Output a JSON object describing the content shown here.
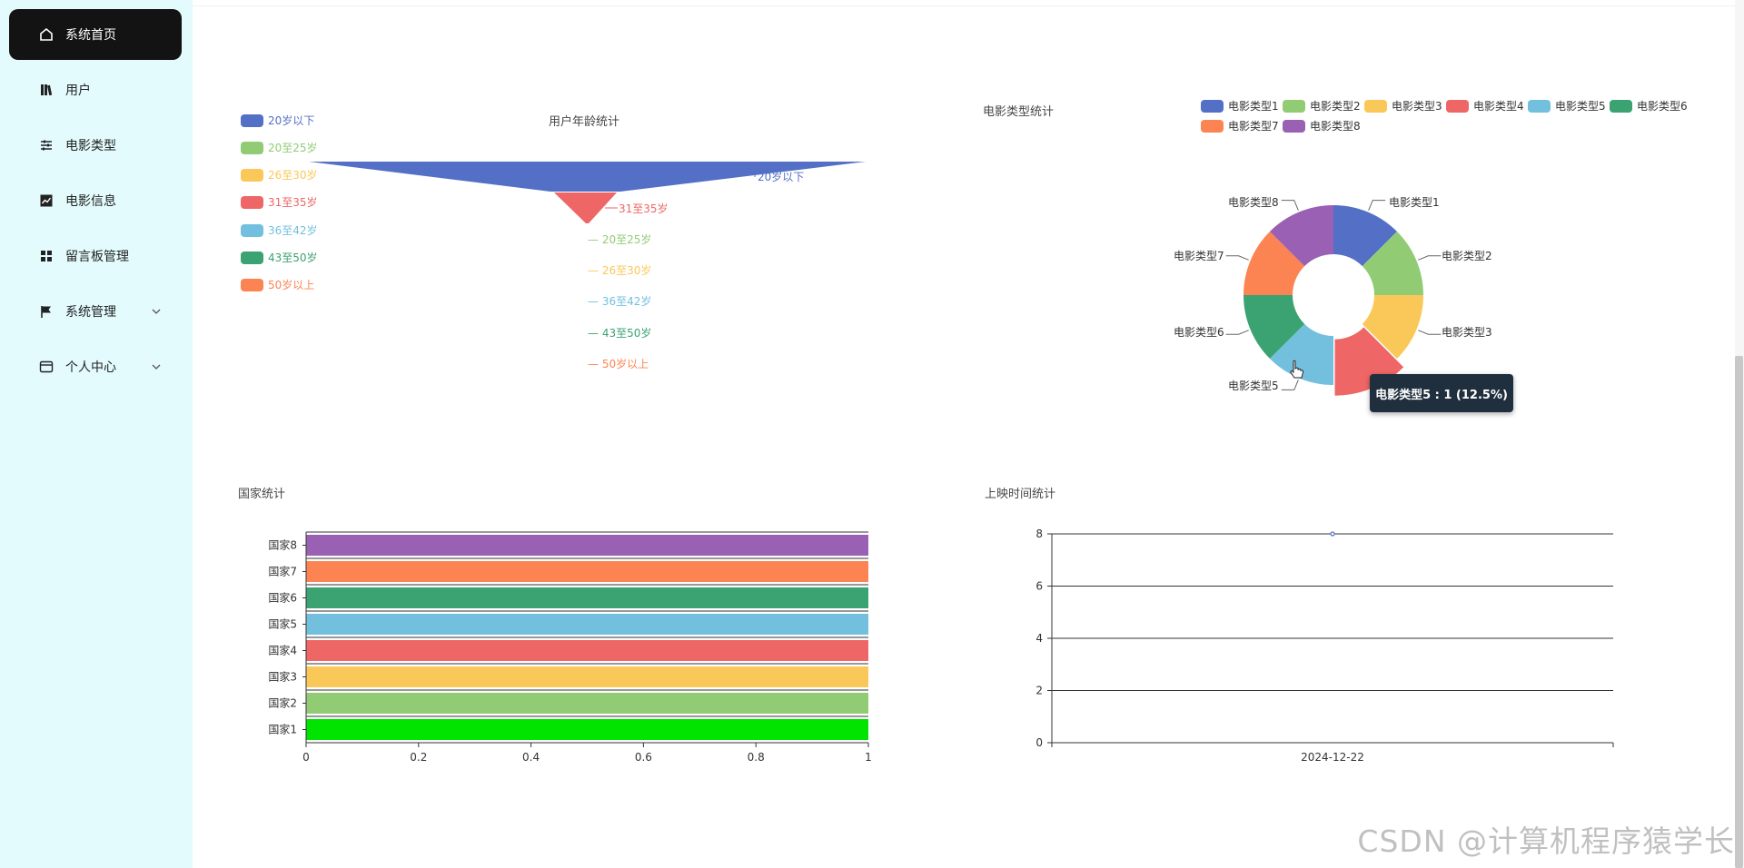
{
  "sidebar": {
    "items": [
      {
        "label": "系统首页",
        "icon": "home-icon",
        "active": true
      },
      {
        "label": "用户",
        "icon": "book-icon"
      },
      {
        "label": "电影类型",
        "icon": "sliders-icon"
      },
      {
        "label": "电影信息",
        "icon": "chart-icon"
      },
      {
        "label": "留言板管理",
        "icon": "grid-icon"
      },
      {
        "label": "系统管理",
        "icon": "flag-icon",
        "expandable": true
      },
      {
        "label": "个人中心",
        "icon": "card-icon",
        "expandable": true
      }
    ]
  },
  "colors": {
    "blue": "#5470c6",
    "green": "#91cc75",
    "yellow": "#fac858",
    "red": "#ee6666",
    "cyan": "#73c0de",
    "teal": "#3ba272",
    "orange": "#fc8452",
    "purple": "#9a60b4",
    "lime": "#00e400"
  },
  "chart_data": [
    {
      "type": "funnel",
      "title": "用户年龄统计",
      "categories": [
        "20岁以下",
        "20至25岁",
        "26至30岁",
        "31至35岁",
        "36至42岁",
        "43至50岁",
        "50岁以上"
      ],
      "values": [
        2,
        0,
        0,
        1,
        0,
        0,
        0
      ],
      "legend_position": "left"
    },
    {
      "type": "pie",
      "title": "电影类型统计",
      "categories": [
        "电影类型1",
        "电影类型2",
        "电影类型3",
        "电影类型4",
        "电影类型5",
        "电影类型6",
        "电影类型7",
        "电影类型8"
      ],
      "values": [
        1,
        1,
        1,
        1,
        1,
        1,
        1,
        1
      ],
      "donut": true,
      "legend_position": "top-right",
      "tooltip": "电影类型5 : 1 (12.5%)"
    },
    {
      "type": "bar",
      "orientation": "horizontal",
      "title": "国家统计",
      "categories": [
        "国家1",
        "国家2",
        "国家3",
        "国家4",
        "国家5",
        "国家6",
        "国家7",
        "国家8"
      ],
      "values": [
        1,
        1,
        1,
        1,
        1,
        1,
        1,
        1
      ],
      "xlim": [
        0,
        1
      ],
      "xticks": [
        "0",
        "0.2",
        "0.4",
        "0.6",
        "0.8",
        "1"
      ]
    },
    {
      "type": "line",
      "title": "上映时间统计",
      "categories": [
        "2024-12-22"
      ],
      "values": [
        8
      ],
      "ylim": [
        0,
        8
      ],
      "yticks": [
        "0",
        "2",
        "4",
        "6",
        "8"
      ]
    }
  ],
  "watermark": "CSDN @计算机程序猿学长"
}
